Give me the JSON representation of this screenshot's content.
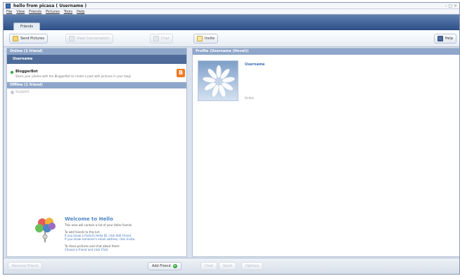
{
  "window": {
    "title": "hello from picasa ( Username )",
    "controls": "– □ ×"
  },
  "menu": [
    "File",
    "View",
    "Friends",
    "Pictures",
    "Tools",
    "Help"
  ],
  "tabs": [
    {
      "label": "Friends"
    }
  ],
  "toolbar": {
    "send_pictures": "Send Pictures",
    "disabled_button": "View Conversation",
    "disabled_small": "Chat",
    "invite": "Invite",
    "help": "Help"
  },
  "friends_panel": {
    "online_header": "Online (1 friend)",
    "user_row": "Username",
    "contact": {
      "name": "BloggerBot",
      "status": "Share your photos with the BloggerBot to create a post with pictures in your blog!"
    },
    "offline_header": "Offline (1 friend)",
    "offline_contact": "Support"
  },
  "welcome": {
    "title": "Welcome to Hello",
    "lines": [
      "This area will contain a list of your Hello friends.",
      "",
      "To add friends to this list:",
      "If you know a friend's Hello ID, click Add Friend.",
      "If you know someone's email address, click Invite.",
      "",
      "To share pictures and chat about them:",
      "Choose a friend and click Chat."
    ]
  },
  "profile": {
    "header": "Profile (Username (Hovel))",
    "name": "Username",
    "status": "Online"
  },
  "bottom_bar": {
    "left_button": "Remove Friend",
    "add_friend": "Add Friend",
    "right_buttons": [
      "Chat",
      "Send",
      "Options"
    ]
  },
  "colors": {
    "accent": "#4e6b99",
    "header": "#8ea6c9",
    "online": "#35a83a",
    "blogger": "#f07a24"
  }
}
